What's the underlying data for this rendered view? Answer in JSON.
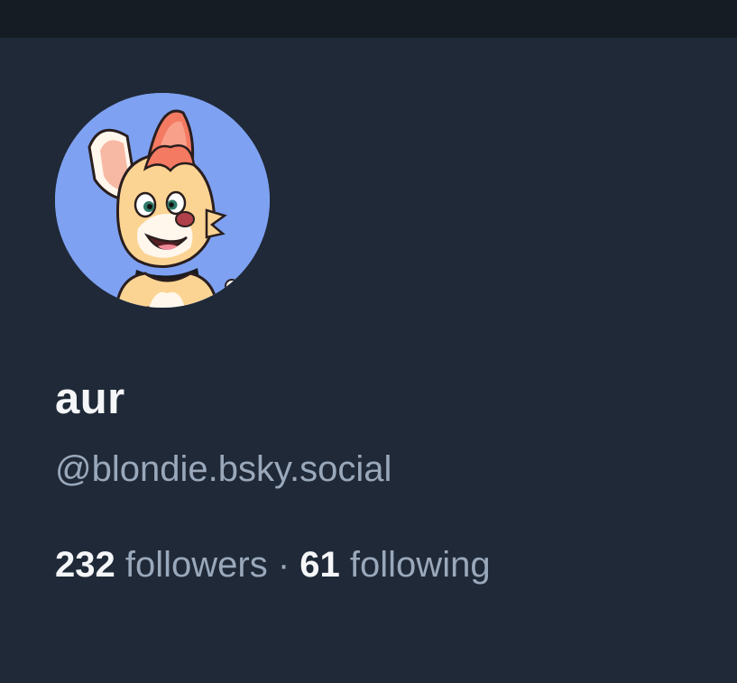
{
  "profile": {
    "display_name": "aur",
    "handle": "@blondie.bsky.social",
    "followers_count": "232",
    "followers_label": "followers",
    "separator": "·",
    "following_count": "61",
    "following_label": "following"
  },
  "colors": {
    "background": "#1f2937",
    "topbar": "#161c24",
    "avatar_bg": "#7ea1f2",
    "primary_text": "#f4f6f8",
    "secondary_text": "#9aa8bb"
  }
}
